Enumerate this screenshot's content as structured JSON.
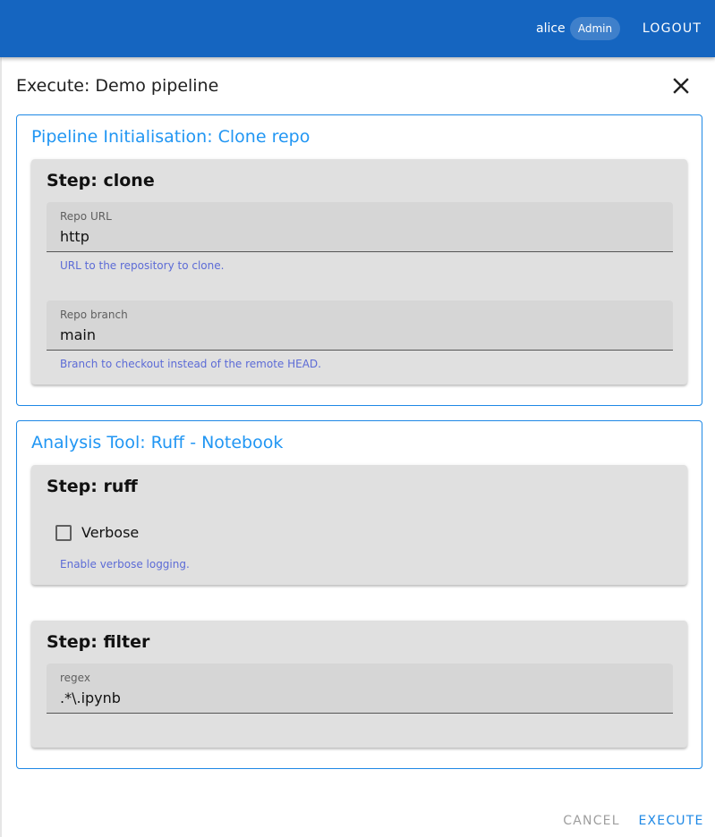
{
  "header": {
    "username": "alice",
    "role": "Admin",
    "logout_label": "LOGOUT"
  },
  "dialog": {
    "title": "Execute: Demo pipeline",
    "close_icon": "close-icon",
    "sections": [
      {
        "title": "Pipeline Initialisation: Clone repo",
        "steps": [
          {
            "title": "Step: clone",
            "fields": [
              {
                "label": "Repo URL",
                "value": "http",
                "hint": "URL to the repository to clone."
              },
              {
                "label": "Repo branch",
                "value": "main",
                "hint": "Branch to checkout instead of the remote HEAD."
              }
            ]
          }
        ]
      },
      {
        "title": "Analysis Tool: Ruff - Notebook",
        "steps": [
          {
            "title": "Step: ruff",
            "checkbox": {
              "label": "Verbose",
              "checked": false,
              "hint": "Enable verbose logging."
            }
          },
          {
            "title": "Step: filter",
            "fields": [
              {
                "label": "regex",
                "value": ".*\\.ipynb"
              }
            ]
          }
        ]
      }
    ],
    "actions": {
      "cancel_label": "CANCEL",
      "execute_label": "EXECUTE"
    }
  },
  "colors": {
    "app_bar": "#1565c0",
    "accent": "#2196f3",
    "hint_text": "#5c6bd6",
    "card_bg": "#e0e0e0"
  }
}
